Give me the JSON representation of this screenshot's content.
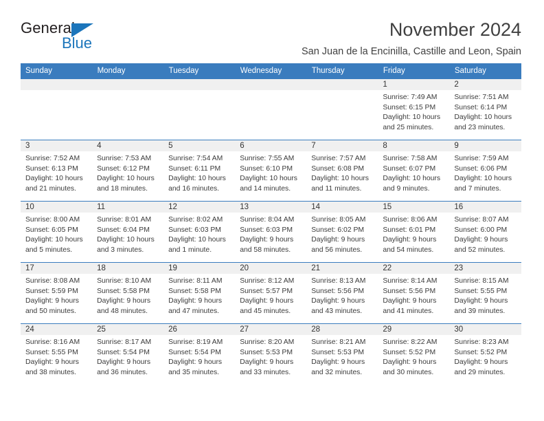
{
  "brand": {
    "name_top": "General",
    "name_bottom": "Blue"
  },
  "header": {
    "title": "November 2024",
    "subtitle": "San Juan de la Encinilla, Castille and Leon, Spain"
  },
  "colors": {
    "header_blue": "#3a7cbe",
    "brand_blue": "#1b75bb",
    "daynum_band": "#f0f0f0",
    "text": "#333333"
  },
  "weekdays": [
    "Sunday",
    "Monday",
    "Tuesday",
    "Wednesday",
    "Thursday",
    "Friday",
    "Saturday"
  ],
  "weeks": [
    [
      {
        "day": "",
        "sunrise": "",
        "sunset": "",
        "daylight_1": "",
        "daylight_2": ""
      },
      {
        "day": "",
        "sunrise": "",
        "sunset": "",
        "daylight_1": "",
        "daylight_2": ""
      },
      {
        "day": "",
        "sunrise": "",
        "sunset": "",
        "daylight_1": "",
        "daylight_2": ""
      },
      {
        "day": "",
        "sunrise": "",
        "sunset": "",
        "daylight_1": "",
        "daylight_2": ""
      },
      {
        "day": "",
        "sunrise": "",
        "sunset": "",
        "daylight_1": "",
        "daylight_2": ""
      },
      {
        "day": "1",
        "sunrise": "Sunrise: 7:49 AM",
        "sunset": "Sunset: 6:15 PM",
        "daylight_1": "Daylight: 10 hours",
        "daylight_2": "and 25 minutes."
      },
      {
        "day": "2",
        "sunrise": "Sunrise: 7:51 AM",
        "sunset": "Sunset: 6:14 PM",
        "daylight_1": "Daylight: 10 hours",
        "daylight_2": "and 23 minutes."
      }
    ],
    [
      {
        "day": "3",
        "sunrise": "Sunrise: 7:52 AM",
        "sunset": "Sunset: 6:13 PM",
        "daylight_1": "Daylight: 10 hours",
        "daylight_2": "and 21 minutes."
      },
      {
        "day": "4",
        "sunrise": "Sunrise: 7:53 AM",
        "sunset": "Sunset: 6:12 PM",
        "daylight_1": "Daylight: 10 hours",
        "daylight_2": "and 18 minutes."
      },
      {
        "day": "5",
        "sunrise": "Sunrise: 7:54 AM",
        "sunset": "Sunset: 6:11 PM",
        "daylight_1": "Daylight: 10 hours",
        "daylight_2": "and 16 minutes."
      },
      {
        "day": "6",
        "sunrise": "Sunrise: 7:55 AM",
        "sunset": "Sunset: 6:10 PM",
        "daylight_1": "Daylight: 10 hours",
        "daylight_2": "and 14 minutes."
      },
      {
        "day": "7",
        "sunrise": "Sunrise: 7:57 AM",
        "sunset": "Sunset: 6:08 PM",
        "daylight_1": "Daylight: 10 hours",
        "daylight_2": "and 11 minutes."
      },
      {
        "day": "8",
        "sunrise": "Sunrise: 7:58 AM",
        "sunset": "Sunset: 6:07 PM",
        "daylight_1": "Daylight: 10 hours",
        "daylight_2": "and 9 minutes."
      },
      {
        "day": "9",
        "sunrise": "Sunrise: 7:59 AM",
        "sunset": "Sunset: 6:06 PM",
        "daylight_1": "Daylight: 10 hours",
        "daylight_2": "and 7 minutes."
      }
    ],
    [
      {
        "day": "10",
        "sunrise": "Sunrise: 8:00 AM",
        "sunset": "Sunset: 6:05 PM",
        "daylight_1": "Daylight: 10 hours",
        "daylight_2": "and 5 minutes."
      },
      {
        "day": "11",
        "sunrise": "Sunrise: 8:01 AM",
        "sunset": "Sunset: 6:04 PM",
        "daylight_1": "Daylight: 10 hours",
        "daylight_2": "and 3 minutes."
      },
      {
        "day": "12",
        "sunrise": "Sunrise: 8:02 AM",
        "sunset": "Sunset: 6:03 PM",
        "daylight_1": "Daylight: 10 hours",
        "daylight_2": "and 1 minute."
      },
      {
        "day": "13",
        "sunrise": "Sunrise: 8:04 AM",
        "sunset": "Sunset: 6:03 PM",
        "daylight_1": "Daylight: 9 hours",
        "daylight_2": "and 58 minutes."
      },
      {
        "day": "14",
        "sunrise": "Sunrise: 8:05 AM",
        "sunset": "Sunset: 6:02 PM",
        "daylight_1": "Daylight: 9 hours",
        "daylight_2": "and 56 minutes."
      },
      {
        "day": "15",
        "sunrise": "Sunrise: 8:06 AM",
        "sunset": "Sunset: 6:01 PM",
        "daylight_1": "Daylight: 9 hours",
        "daylight_2": "and 54 minutes."
      },
      {
        "day": "16",
        "sunrise": "Sunrise: 8:07 AM",
        "sunset": "Sunset: 6:00 PM",
        "daylight_1": "Daylight: 9 hours",
        "daylight_2": "and 52 minutes."
      }
    ],
    [
      {
        "day": "17",
        "sunrise": "Sunrise: 8:08 AM",
        "sunset": "Sunset: 5:59 PM",
        "daylight_1": "Daylight: 9 hours",
        "daylight_2": "and 50 minutes."
      },
      {
        "day": "18",
        "sunrise": "Sunrise: 8:10 AM",
        "sunset": "Sunset: 5:58 PM",
        "daylight_1": "Daylight: 9 hours",
        "daylight_2": "and 48 minutes."
      },
      {
        "day": "19",
        "sunrise": "Sunrise: 8:11 AM",
        "sunset": "Sunset: 5:58 PM",
        "daylight_1": "Daylight: 9 hours",
        "daylight_2": "and 47 minutes."
      },
      {
        "day": "20",
        "sunrise": "Sunrise: 8:12 AM",
        "sunset": "Sunset: 5:57 PM",
        "daylight_1": "Daylight: 9 hours",
        "daylight_2": "and 45 minutes."
      },
      {
        "day": "21",
        "sunrise": "Sunrise: 8:13 AM",
        "sunset": "Sunset: 5:56 PM",
        "daylight_1": "Daylight: 9 hours",
        "daylight_2": "and 43 minutes."
      },
      {
        "day": "22",
        "sunrise": "Sunrise: 8:14 AM",
        "sunset": "Sunset: 5:56 PM",
        "daylight_1": "Daylight: 9 hours",
        "daylight_2": "and 41 minutes."
      },
      {
        "day": "23",
        "sunrise": "Sunrise: 8:15 AM",
        "sunset": "Sunset: 5:55 PM",
        "daylight_1": "Daylight: 9 hours",
        "daylight_2": "and 39 minutes."
      }
    ],
    [
      {
        "day": "24",
        "sunrise": "Sunrise: 8:16 AM",
        "sunset": "Sunset: 5:55 PM",
        "daylight_1": "Daylight: 9 hours",
        "daylight_2": "and 38 minutes."
      },
      {
        "day": "25",
        "sunrise": "Sunrise: 8:17 AM",
        "sunset": "Sunset: 5:54 PM",
        "daylight_1": "Daylight: 9 hours",
        "daylight_2": "and 36 minutes."
      },
      {
        "day": "26",
        "sunrise": "Sunrise: 8:19 AM",
        "sunset": "Sunset: 5:54 PM",
        "daylight_1": "Daylight: 9 hours",
        "daylight_2": "and 35 minutes."
      },
      {
        "day": "27",
        "sunrise": "Sunrise: 8:20 AM",
        "sunset": "Sunset: 5:53 PM",
        "daylight_1": "Daylight: 9 hours",
        "daylight_2": "and 33 minutes."
      },
      {
        "day": "28",
        "sunrise": "Sunrise: 8:21 AM",
        "sunset": "Sunset: 5:53 PM",
        "daylight_1": "Daylight: 9 hours",
        "daylight_2": "and 32 minutes."
      },
      {
        "day": "29",
        "sunrise": "Sunrise: 8:22 AM",
        "sunset": "Sunset: 5:52 PM",
        "daylight_1": "Daylight: 9 hours",
        "daylight_2": "and 30 minutes."
      },
      {
        "day": "30",
        "sunrise": "Sunrise: 8:23 AM",
        "sunset": "Sunset: 5:52 PM",
        "daylight_1": "Daylight: 9 hours",
        "daylight_2": "and 29 minutes."
      }
    ]
  ]
}
